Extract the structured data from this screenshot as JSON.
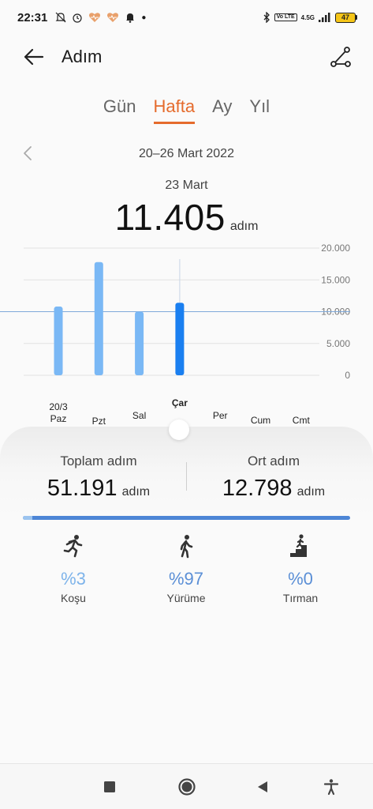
{
  "status": {
    "time": "22:31",
    "network": "4.5G",
    "lte": "Vo LTE",
    "battery": "47"
  },
  "header": {
    "title": "Adım"
  },
  "tabs": [
    {
      "label": "Gün",
      "active": false
    },
    {
      "label": "Hafta",
      "active": true
    },
    {
      "label": "Ay",
      "active": false
    },
    {
      "label": "Yıl",
      "active": false
    }
  ],
  "date_range": "20–26 Mart 2022",
  "selected": {
    "date": "23 Mart",
    "value": "11.405",
    "unit": "adım"
  },
  "chart_data": {
    "type": "bar",
    "categories": [
      "Paz",
      "Pzt",
      "Sal",
      "Çar",
      "Per",
      "Cum",
      "Cmt"
    ],
    "first_date_label": "20/3",
    "values": [
      10800,
      17800,
      10000,
      11405,
      0,
      0,
      0
    ],
    "selected_index": 3,
    "ylim": [
      0,
      20000
    ],
    "yticks": [
      "20.000",
      "15.000",
      "10.000",
      "5.000",
      "0"
    ],
    "goal": 10000,
    "colors": {
      "bar": "#7ab8f5",
      "selected": "#1a7ff0",
      "grid": "#e2e2e2",
      "goal": "#7fa9da"
    }
  },
  "stats": {
    "total": {
      "label": "Toplam adım",
      "value": "51.191",
      "unit": "adım"
    },
    "average": {
      "label": "Ort adım",
      "value": "12.798",
      "unit": "adım"
    }
  },
  "activity_split": [
    {
      "name": "Koşu",
      "percent": "%3",
      "share": 3,
      "icon": "running-icon"
    },
    {
      "name": "Yürüme",
      "percent": "%97",
      "share": 97,
      "icon": "walking-icon"
    },
    {
      "name": "Tırman",
      "percent": "%0",
      "share": 0,
      "icon": "climbing-icon"
    }
  ]
}
